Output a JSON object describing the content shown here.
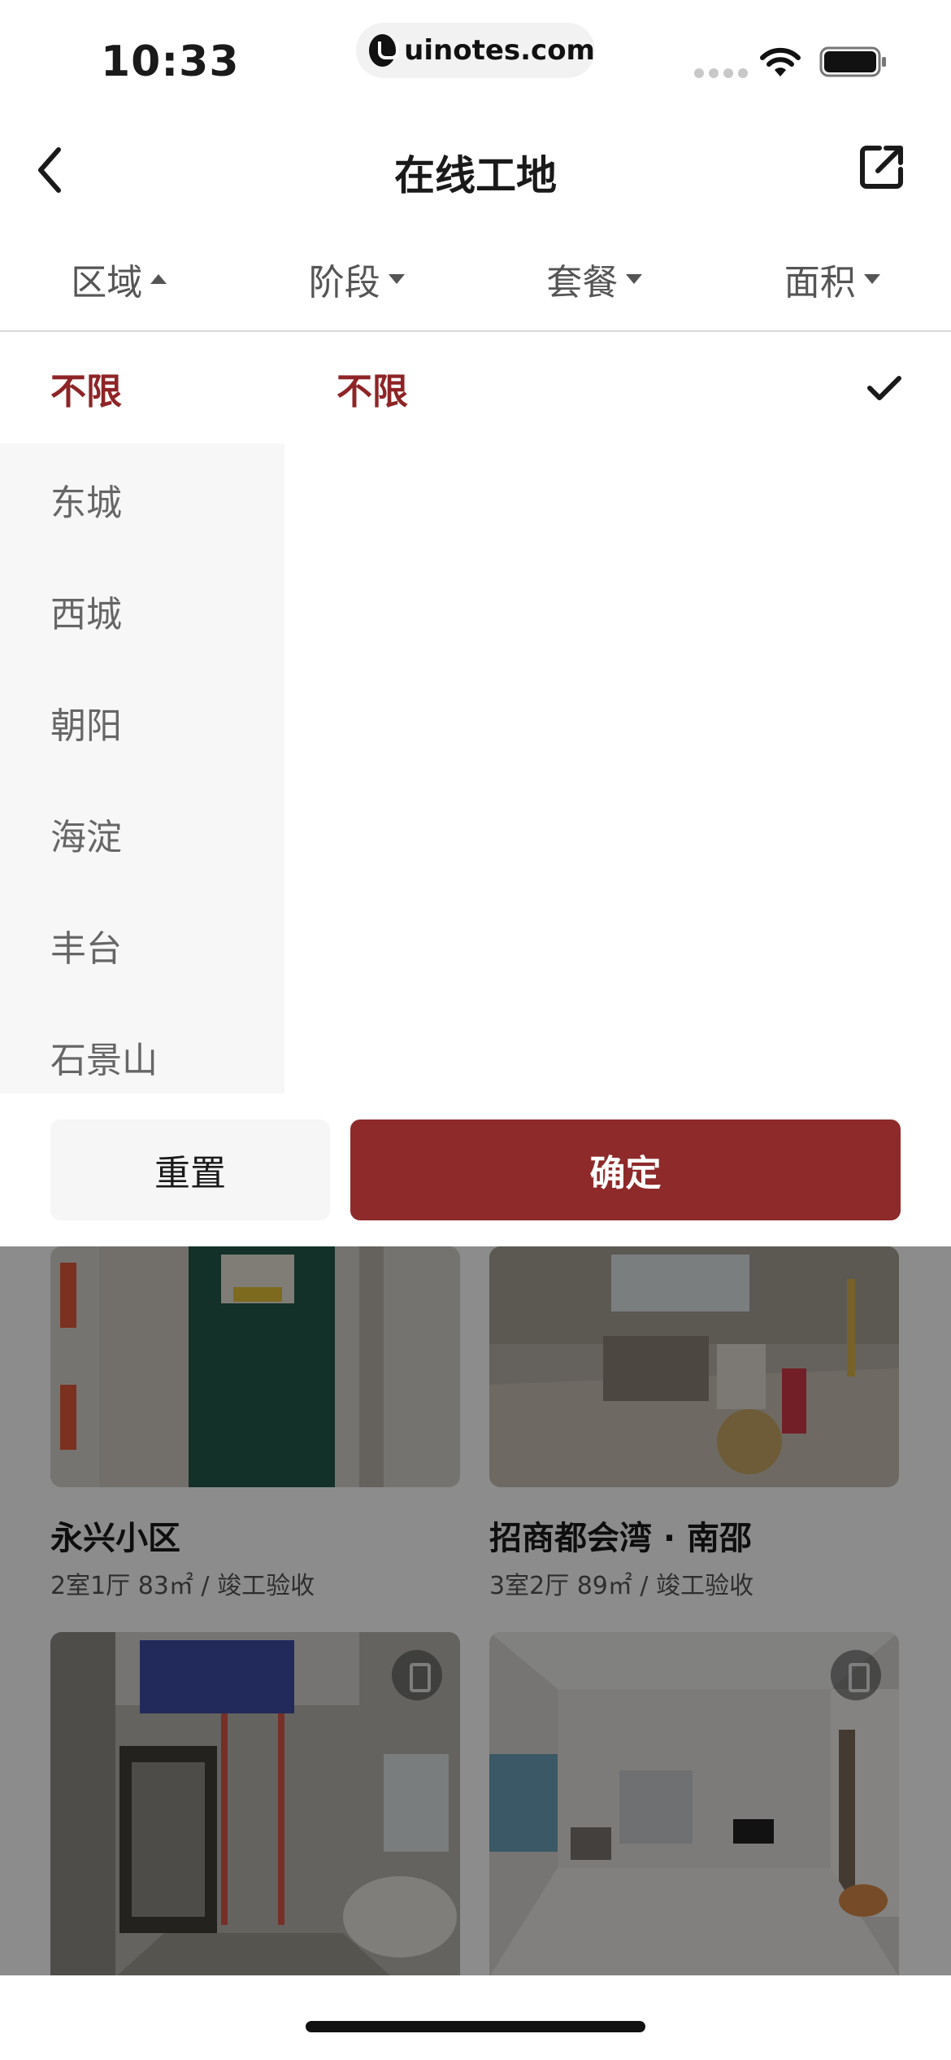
{
  "status_bar": {
    "time": "10:33",
    "url": "uinotes.com",
    "icons": [
      "signal-dots-icon",
      "wifi-icon",
      "battery-icon"
    ]
  },
  "nav": {
    "title": "在线工地",
    "back_icon": "chevron-left-icon",
    "share_icon": "share-external-icon"
  },
  "filters": [
    {
      "label": "区域",
      "state": "open"
    },
    {
      "label": "阶段",
      "state": "closed"
    },
    {
      "label": "套餐",
      "state": "closed"
    },
    {
      "label": "面积",
      "state": "closed"
    }
  ],
  "region_list": {
    "items": [
      "不限",
      "东城",
      "西城",
      "朝阳",
      "海淀",
      "丰台",
      "石景山"
    ],
    "selected": "不限"
  },
  "sub_region": {
    "selected": "不限",
    "check_icon": "checkmark-icon"
  },
  "buttons": {
    "reset": "重置",
    "confirm": "确定"
  },
  "cards": [
    {
      "name": "永兴小区",
      "meta": "2室1厅 83㎡ / 竣工验收"
    },
    {
      "name": "招商都会湾 · 南邵",
      "meta": "3室2厅 89㎡ / 竣工验收"
    },
    {
      "name": "",
      "meta": ""
    },
    {
      "name": "",
      "meta": ""
    }
  ],
  "colors": {
    "accent": "#8e2a2a",
    "active_text": "#8e2426",
    "overlay": "rgba(0,0,0,0.45)"
  }
}
